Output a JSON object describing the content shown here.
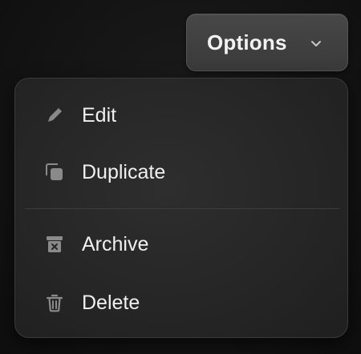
{
  "trigger": {
    "label": "Options",
    "icon": "chevron-down-icon"
  },
  "menu": {
    "items": [
      {
        "label": "Edit",
        "icon": "pencil-icon"
      },
      {
        "label": "Duplicate",
        "icon": "copy-icon"
      },
      {
        "label": "Archive",
        "icon": "archive-icon"
      },
      {
        "label": "Delete",
        "icon": "trash-icon"
      }
    ]
  },
  "colors": {
    "icon": "#8a8a8a",
    "text": "#f0f0f0",
    "background": "#121212",
    "menu_background": "#2a2a2a",
    "trigger_background": "#404040"
  }
}
